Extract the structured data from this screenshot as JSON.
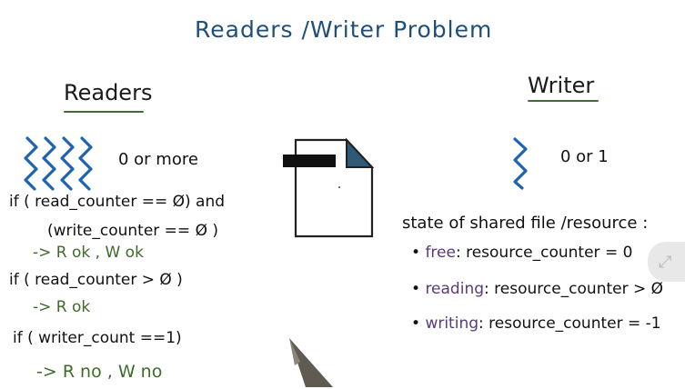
{
  "title": "Readers /Writer Problem",
  "readers": {
    "heading": "Readers",
    "count_label": "0 or more",
    "cond1_line1": "if ( read_counter == Ø) and",
    "cond1_line2": "(write_counter == Ø )",
    "cond1_result": "-> R ok , W ok",
    "cond2_line1": "if  ( read_counter > Ø )",
    "cond2_result": "-> R ok",
    "cond3_line1": "if  ( writer_count ==1)",
    "cond3_result": "-> R no ,  W no"
  },
  "writer": {
    "heading": "Writer",
    "count_label": "0 or 1",
    "state_heading": "state of shared file /resource :",
    "states": [
      {
        "name": "free",
        "expr": ": resource_counter = 0"
      },
      {
        "name": "reading",
        "expr": ": resource_counter > Ø"
      },
      {
        "name": "writing",
        "expr": ": resource_counter = -1"
      }
    ]
  },
  "colors": {
    "title": "#1e4e7a",
    "wave": "#1f63b5",
    "green_ink": "#3e6b2a",
    "purple_ink": "#5a3a78",
    "file_corner": "#2e5a78"
  },
  "icons": [
    "reader-squiggle-icon",
    "writer-squiggle-icon",
    "file-icon",
    "pen-tip",
    "resize-icon"
  ]
}
